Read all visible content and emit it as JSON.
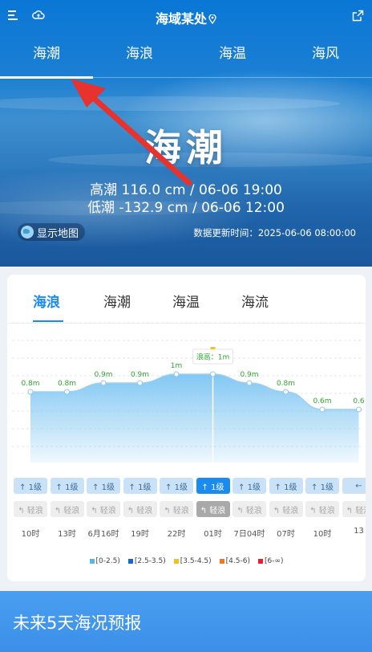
{
  "header": {
    "location": "海域某处"
  },
  "tabs": [
    {
      "label": "海潮",
      "active": true
    },
    {
      "label": "海浪",
      "active": false
    },
    {
      "label": "海温",
      "active": false
    },
    {
      "label": "海风",
      "active": false
    }
  ],
  "hero": {
    "title": "海潮",
    "high_tide": "高潮 116.0 cm / 06-06 19:00",
    "low_tide": "低潮 -132.9 cm / 06-06 12:00",
    "map_button": "显示地图",
    "update_time": "数据更新时间：2025-06-06 08:00:00"
  },
  "card": {
    "subtabs": [
      {
        "label": "海浪",
        "active": true
      },
      {
        "label": "海潮",
        "active": false
      },
      {
        "label": "海温",
        "active": false
      },
      {
        "label": "海流",
        "active": false
      }
    ],
    "tooltip": "浪高：1m"
  },
  "chart_data": {
    "type": "area",
    "x": [
      "10时",
      "13时",
      "6月16时",
      "19时",
      "22时",
      "01时",
      "7日04时",
      "07时",
      "10时",
      "13"
    ],
    "series": [
      {
        "values": [
          0.8,
          0.8,
          0.9,
          0.9,
          1.0,
          1.0,
          0.9,
          0.8,
          0.6,
          0.6
        ]
      }
    ],
    "data_labels": [
      "0.8m",
      "0.8m",
      "0.9m",
      "0.9m",
      "1m",
      "",
      "0.9m",
      "0.8m",
      "0.6m",
      "0.6"
    ],
    "selected_index": 5,
    "color": "#1a8cf0",
    "fill_color": "#7cc4f2",
    "label_color": "#2ea52e",
    "ylim": [
      0,
      1.4
    ],
    "grid": true,
    "legend_position": "bottom"
  },
  "wind_directions": [
    "1级",
    "1级",
    "1级",
    "1级",
    "1级",
    "1级",
    "1级",
    "1级",
    "1级",
    ""
  ],
  "wave_levels": [
    "轻浪",
    "轻浪",
    "轻浪",
    "轻浪",
    "轻浪",
    "轻浪",
    "轻浪",
    "轻浪",
    "轻浪",
    "轻浪"
  ],
  "legend": [
    {
      "label": "[0-2.5)",
      "color": "#5bb4ea"
    },
    {
      "label": "[2.5-3.5)",
      "color": "#1567c9"
    },
    {
      "label": "[3.5-4.5)",
      "color": "#f2c21b"
    },
    {
      "label": "[4.5-6)",
      "color": "#ef7a22"
    },
    {
      "label": "[6-∞)",
      "color": "#e0242a"
    }
  ],
  "forecast": {
    "label": "未来5天海况预报"
  }
}
